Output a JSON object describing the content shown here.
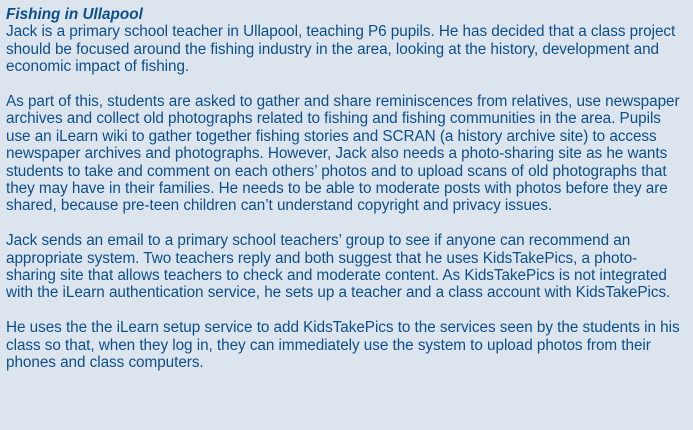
{
  "title": "Fishing in Ullapool",
  "paragraphs": [
    "Jack is a primary school teacher in Ullapool, teaching P6 pupils. He has decided that a class project should be focused around the fishing industry in the area, looking at the history, development and economic impact of fishing.",
    "As part of this, students are asked to gather and share reminiscences from relatives, use newspaper archives and collect old photographs related to fishing and fishing communities in the area. Pupils use an iLearn wiki to gather together fishing stories and SCRAN (a history archive site) to access newspaper archives and photographs. However, Jack also needs a photo-sharing site as he wants students to take and comment on each others’ photos and to upload scans of old photographs that they may have in their families. He needs to be able to moderate posts with photos before they are shared, because pre-teen children can’t understand copyright and privacy issues.",
    "Jack sends an email to a primary school teachers’ group to see if anyone can recommend an appropriate system. Two teachers reply and both suggest that he uses KidsTakePics, a photo-sharing site that allows teachers to check and moderate content. As KidsTakePics is not integrated with the iLearn authentication service, he sets up a teacher and a class account with KidsTakePics.",
    "He uses the  the iLearn setup service to add KidsTakePics to the services seen by the students in his class so that, when they log in, they can immediately use the system to upload photos from their phones and class computers."
  ]
}
